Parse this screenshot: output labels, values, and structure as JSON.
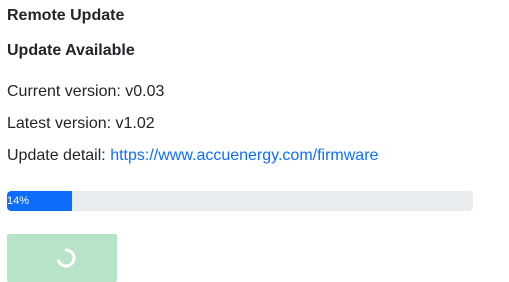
{
  "page": {
    "section_title": "Remote Update",
    "status_heading": "Update Available"
  },
  "versions": {
    "current_label": "Current version:",
    "current_value": "v0.03",
    "latest_label": "Latest version:",
    "latest_value": "v1.02"
  },
  "update_detail": {
    "label": "Update detail:",
    "link_text": "https://www.accuenergy.com/firmware"
  },
  "progress": {
    "value_percent": 14,
    "label": "14%"
  },
  "update_button": {
    "state": "loading",
    "icon": "spinner-icon",
    "color": "#b7e4c7"
  },
  "colors": {
    "link": "#0d6efd",
    "progress_fill": "#0d6efd",
    "progress_track": "#e9ecef",
    "button_bg": "#b7e4c7"
  }
}
